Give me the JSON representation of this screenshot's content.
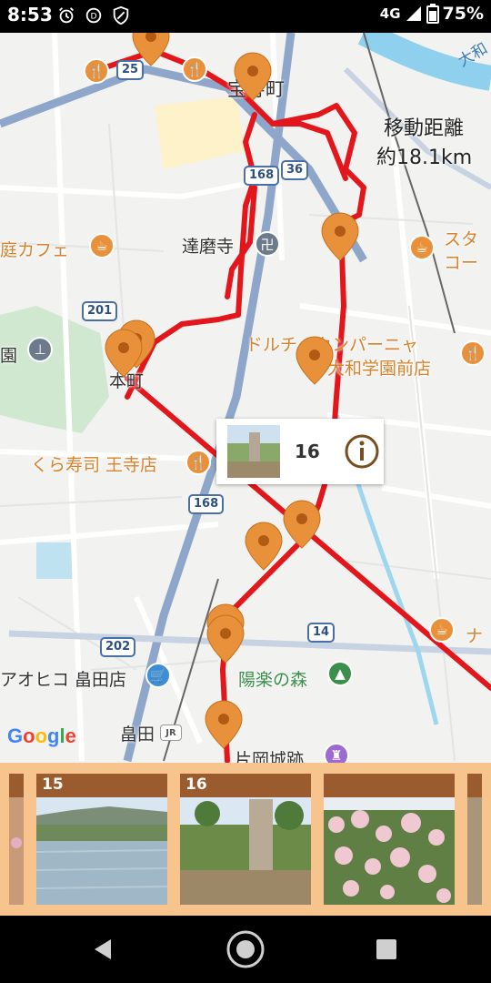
{
  "status_bar": {
    "time": "8:53",
    "network": "4G",
    "battery": "75%",
    "icons": [
      "alarm-icon",
      "data-saver-icon",
      "shield-icon",
      "signal-icon",
      "battery-icon"
    ]
  },
  "map": {
    "labels": {
      "area_houjucho": "宝寿町",
      "distance_label": "移動距離",
      "distance_value": "約18.1km",
      "daruma_temple": "達磨寺",
      "niwa_cafe": "庭カフェ",
      "sta_cafe_line1": "スタ",
      "sta_cafe_line2": "コー",
      "en_label": "園",
      "honmachi": "本町",
      "dolce_line1": "ドルチェカンパーニャ",
      "dolce_line2": "大和学園前店",
      "kura_sushi": "くら寿司 王寺店",
      "ohiko": "アオヒコ 畠田店",
      "yoraku_forest": "陽楽の森",
      "hatada": "畠田",
      "kataoka_castle": "片岡城跡",
      "na_label": "ナ",
      "yamato_label": "大和"
    },
    "route_shields": [
      "25",
      "168",
      "36",
      "201",
      "168",
      "202",
      "14"
    ],
    "route_color": "#e3161b",
    "marker_color": "#e8913a",
    "google_logo": [
      "G",
      "o",
      "o",
      "g",
      "l",
      "e"
    ]
  },
  "info_window": {
    "number": "16",
    "icon": "info-icon"
  },
  "photo_strip": {
    "cards": [
      {
        "number": "15",
        "photo": "rice-field-photo"
      },
      {
        "number": "16",
        "photo": "stone-monument-photo"
      },
      {
        "number": "",
        "photo": "pink-flowers-photo"
      }
    ],
    "background_color": "#f6c48c",
    "header_color": "#9a5b2e"
  },
  "nav_bar": {
    "buttons": [
      "back-button",
      "home-button",
      "recents-button"
    ]
  }
}
